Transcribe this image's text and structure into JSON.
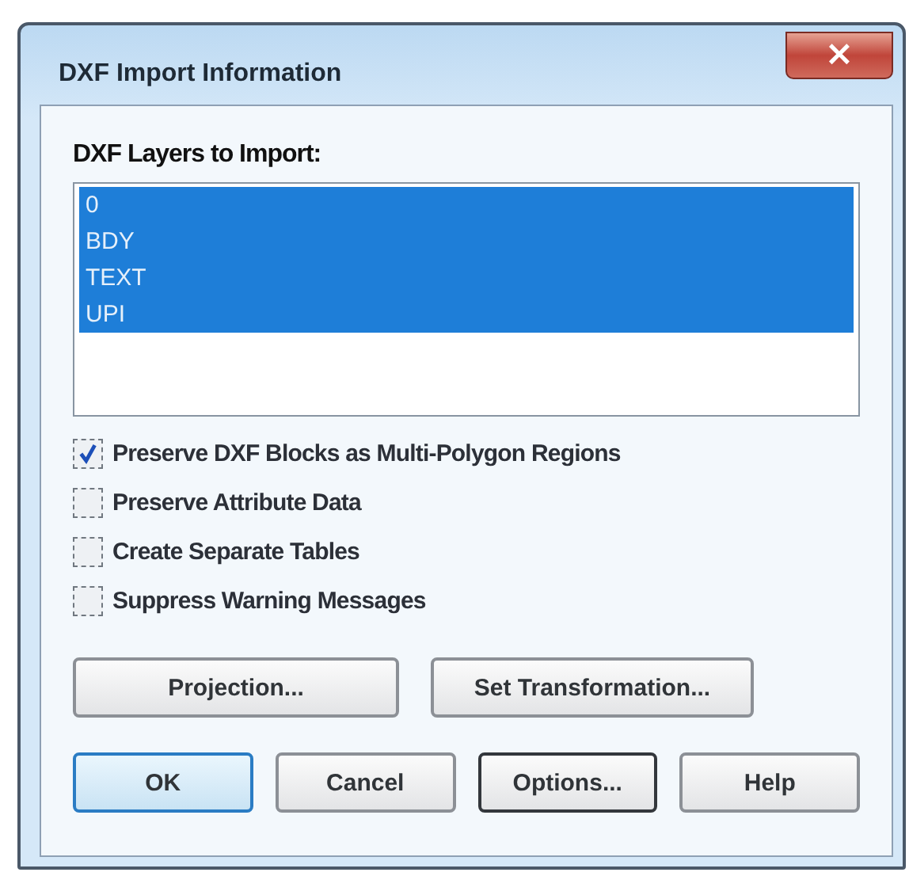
{
  "window": {
    "title": "DXF Import Information",
    "close": "×"
  },
  "layers": {
    "label": "DXF Layers to Import:",
    "items": [
      {
        "name": "0",
        "selected": true
      },
      {
        "name": "BDY",
        "selected": true
      },
      {
        "name": "TEXT",
        "selected": true
      },
      {
        "name": "UPI",
        "selected": true
      }
    ]
  },
  "options": [
    {
      "label": "Preserve DXF Blocks as Multi-Polygon Regions",
      "checked": true
    },
    {
      "label": "Preserve Attribute Data",
      "checked": false
    },
    {
      "label": "Create Separate Tables",
      "checked": false
    },
    {
      "label": "Suppress Warning Messages",
      "checked": false
    }
  ],
  "setup_buttons": [
    "Projection...",
    "Set Transformation..."
  ],
  "buttons": [
    {
      "label": "OK",
      "default": true,
      "focused": false
    },
    {
      "label": "Cancel",
      "default": false,
      "focused": false
    },
    {
      "label": "Options...",
      "default": false,
      "focused": true
    },
    {
      "label": "Help",
      "default": false,
      "focused": false
    }
  ]
}
